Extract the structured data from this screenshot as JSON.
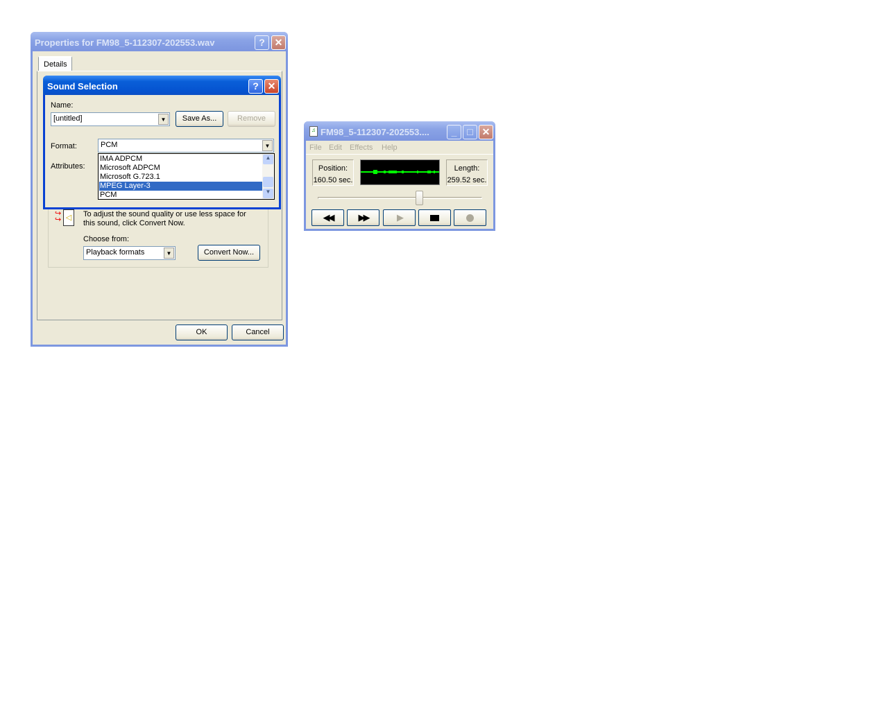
{
  "properties": {
    "title": "Properties for FM98_5-112307-202553.wav",
    "tab": "Details",
    "convert_text_1": "To adjust the sound quality or use less space for",
    "convert_text_2": "this sound, click Convert Now.",
    "choose_label": "Choose from:",
    "choose_value": "Playback formats",
    "convert_button": "Convert Now...",
    "ok": "OK",
    "cancel": "Cancel"
  },
  "sound_selection": {
    "title": "Sound Selection",
    "name_label": "Name:",
    "name_value": "[untitled]",
    "save_as": "Save As...",
    "remove": "Remove",
    "format_label": "Format:",
    "format_value": "PCM",
    "attributes_label": "Attributes:",
    "format_options": [
      "IMA ADPCM",
      "Microsoft ADPCM",
      "Microsoft G.723.1",
      "MPEG Layer-3",
      "PCM"
    ],
    "selected_option": "MPEG Layer-3"
  },
  "recorder": {
    "title": "FM98_5-112307-202553....",
    "menu": [
      "File",
      "Edit",
      "Effects",
      "Help"
    ],
    "position_label": "Position:",
    "position_value": "160.50 sec.",
    "length_label": "Length:",
    "length_value": "259.52 sec.",
    "slider_fraction": 0.618,
    "wave_color": "#00ff00"
  },
  "colors": {
    "selection": "#316ac5",
    "active_title": "#0a5fd8"
  }
}
